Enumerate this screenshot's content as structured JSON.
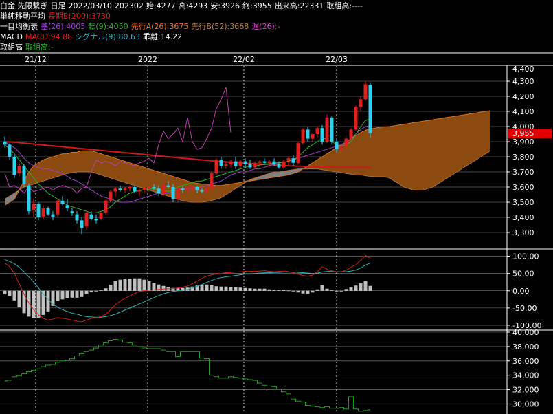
{
  "header": {
    "line1": {
      "instrument": "白金 先限繋ぎ",
      "period": "日足",
      "date": "2022/03/10",
      "contract": "202302",
      "open": "始:4277",
      "high": "高:4293",
      "low": "安:3926",
      "close": "終:3955",
      "volume": "出来高:22331",
      "oi": "取組高:----"
    },
    "line2": {
      "label": "単純移動平均",
      "ma": "長期B(200):3730"
    },
    "line3": {
      "label": "一目均衡表",
      "base": "基(26):4005",
      "conv": "転(9):4050",
      "spanA": "先行A(26):3675",
      "spanB": "先行B(52):3668",
      "lag": "遅(26):-"
    },
    "line4": {
      "label": "MACD",
      "macd": "MACD:94.88",
      "signal": "シグナル(9):80.63",
      "hist": "乖離:14.22"
    },
    "line5": {
      "label": "取組高",
      "oi": "取組高:-"
    }
  },
  "colors": {
    "up": "#e02020",
    "down": "#30d0f0",
    "ma200": "#d01818",
    "base": "#a040d0",
    "conv": "#28b828",
    "lag": "#c040b0",
    "cloud_bull": "#8a4a10",
    "cloud_bear": "#808080",
    "macd": "#d02020",
    "signal": "#30b0b8",
    "hist": "#c0c0c0",
    "oi_line": "#20a020",
    "price_badge": "#e00000"
  },
  "chart_data": [
    {
      "type": "candlestick",
      "title": "",
      "x_ticks": [
        "21/12",
        "2022",
        "22/02",
        "22/03"
      ],
      "ylim": [
        3200,
        4400
      ],
      "y_ticks": [
        3300,
        3400,
        3500,
        3600,
        3700,
        3800,
        3900,
        4000,
        4100,
        4200,
        4300
      ],
      "y_tick_labels": [
        "3,300",
        "3,400",
        "3,500",
        "3,600",
        "3,700",
        "3,800",
        "3,900",
        "4,000",
        "4,100",
        "4,200",
        "4,300",
        "4,400"
      ],
      "current_price": 3955,
      "current_price_label": "3,955",
      "ohlc": [
        [
          3900,
          3935,
          3860,
          3880
        ],
        [
          3880,
          3890,
          3780,
          3800
        ],
        [
          3800,
          3810,
          3660,
          3680
        ],
        [
          3690,
          3760,
          3670,
          3740
        ],
        [
          3740,
          3750,
          3600,
          3620
        ],
        [
          3610,
          3625,
          3420,
          3440
        ],
        [
          3450,
          3520,
          3400,
          3490
        ],
        [
          3490,
          3500,
          3380,
          3400
        ],
        [
          3405,
          3480,
          3390,
          3460
        ],
        [
          3460,
          3470,
          3410,
          3420
        ],
        [
          3420,
          3440,
          3380,
          3400
        ],
        [
          3420,
          3520,
          3400,
          3510
        ],
        [
          3510,
          3540,
          3480,
          3490
        ],
        [
          3480,
          3520,
          3440,
          3460
        ],
        [
          3440,
          3460,
          3410,
          3430
        ],
        [
          3420,
          3440,
          3360,
          3380
        ],
        [
          3380,
          3400,
          3290,
          3330
        ],
        [
          3340,
          3440,
          3320,
          3430
        ],
        [
          3420,
          3440,
          3380,
          3390
        ],
        [
          3390,
          3420,
          3360,
          3380
        ],
        [
          3390,
          3440,
          3380,
          3430
        ],
        [
          3430,
          3520,
          3420,
          3510
        ],
        [
          3510,
          3580,
          3500,
          3570
        ],
        [
          3570,
          3600,
          3540,
          3590
        ],
        [
          3590,
          3610,
          3570,
          3580
        ],
        [
          3580,
          3600,
          3560,
          3590
        ],
        [
          3590,
          3610,
          3570,
          3600
        ],
        [
          3600,
          3610,
          3560,
          3570
        ],
        [
          3570,
          3590,
          3540,
          3580
        ],
        [
          3580,
          3600,
          3560,
          3590
        ],
        [
          3590,
          3610,
          3570,
          3600
        ],
        [
          3600,
          3620,
          3580,
          3590
        ],
        [
          3590,
          3610,
          3540,
          3560
        ],
        [
          3560,
          3620,
          3540,
          3610
        ],
        [
          3610,
          3640,
          3590,
          3600
        ],
        [
          3600,
          3620,
          3500,
          3520
        ],
        [
          3520,
          3600,
          3500,
          3590
        ],
        [
          3590,
          3610,
          3560,
          3580
        ],
        [
          3580,
          3600,
          3560,
          3590
        ],
        [
          3590,
          3610,
          3570,
          3600
        ],
        [
          3600,
          3610,
          3560,
          3580
        ],
        [
          3580,
          3590,
          3560,
          3570
        ],
        [
          3570,
          3600,
          3560,
          3590
        ],
        [
          3590,
          3700,
          3580,
          3690
        ],
        [
          3690,
          3790,
          3680,
          3780
        ],
        [
          3780,
          3800,
          3720,
          3740
        ],
        [
          3740,
          3770,
          3720,
          3750
        ],
        [
          3750,
          3780,
          3730,
          3770
        ],
        [
          3770,
          3800,
          3720,
          3740
        ],
        [
          3740,
          3780,
          3720,
          3770
        ],
        [
          3770,
          3790,
          3730,
          3750
        ],
        [
          3750,
          3780,
          3720,
          3730
        ],
        [
          3730,
          3770,
          3720,
          3760
        ],
        [
          3760,
          3780,
          3740,
          3770
        ],
        [
          3770,
          3790,
          3750,
          3760
        ],
        [
          3760,
          3780,
          3740,
          3770
        ],
        [
          3770,
          3790,
          3740,
          3750
        ],
        [
          3750,
          3770,
          3720,
          3730
        ],
        [
          3730,
          3780,
          3720,
          3770
        ],
        [
          3770,
          3800,
          3740,
          3790
        ],
        [
          3790,
          3810,
          3740,
          3760
        ],
        [
          3760,
          3900,
          3750,
          3890
        ],
        [
          3890,
          3990,
          3880,
          3980
        ],
        [
          3980,
          4000,
          3900,
          3920
        ],
        [
          3920,
          3960,
          3900,
          3950
        ],
        [
          3950,
          4000,
          3930,
          3990
        ],
        [
          3990,
          4010,
          3880,
          3900
        ],
        [
          3900,
          4080,
          3890,
          4060
        ],
        [
          4060,
          4070,
          3880,
          3900
        ],
        [
          3900,
          3920,
          3830,
          3850
        ],
        [
          3850,
          3880,
          3830,
          3870
        ],
        [
          3870,
          3930,
          3860,
          3920
        ],
        [
          3920,
          3990,
          3900,
          3980
        ],
        [
          3980,
          4140,
          3970,
          4130
        ],
        [
          4130,
          4200,
          4100,
          4180
        ],
        [
          4180,
          4300,
          4170,
          4280
        ],
        [
          4277,
          4293,
          3926,
          3955
        ]
      ],
      "ma200": [
        3900,
        3898,
        3896,
        3893,
        3890,
        3887,
        3884,
        3881,
        3878,
        3875,
        3872,
        3869,
        3866,
        3863,
        3860,
        3857,
        3854,
        3851,
        3848,
        3845,
        3842,
        3839,
        3836,
        3833,
        3830,
        3827,
        3824,
        3821,
        3818,
        3815,
        3812,
        3809,
        3806,
        3803,
        3800,
        3797,
        3794,
        3791,
        3788,
        3785,
        3782,
        3779,
        3776,
        3773,
        3770,
        3768,
        3766,
        3764,
        3762,
        3760,
        3758,
        3756,
        3754,
        3752,
        3750,
        3748,
        3746,
        3744,
        3742,
        3740,
        3739,
        3738,
        3737,
        3736,
        3735,
        3734,
        3733,
        3732,
        3731,
        3730,
        3730,
        3730,
        3730,
        3730,
        3730,
        3730,
        3730
      ],
      "kijun": [
        3900,
        3880,
        3860,
        3830,
        3790,
        3760,
        3740,
        3730,
        3720,
        3720,
        3710,
        3700,
        3690,
        3670,
        3650,
        3640,
        3620,
        3600,
        3580,
        3560,
        3540,
        3530,
        3520,
        3510,
        3500,
        3500,
        3500,
        3510,
        3520,
        3530,
        3540,
        3550,
        3560,
        3560,
        3560,
        3570,
        3580,
        3590,
        3590,
        3590,
        3600,
        3600,
        3610,
        3620,
        3630,
        3640,
        3660,
        3680,
        3690,
        3700,
        3700,
        3710,
        3720,
        3720,
        3730,
        3740,
        3750,
        3760,
        3760,
        3770,
        3780,
        3790,
        3800,
        3810,
        3820,
        3830,
        3840,
        3850,
        3860,
        3870,
        3880,
        3900,
        3920,
        3950,
        3980,
        4000,
        4005
      ],
      "tenkan": [
        3880,
        3850,
        3820,
        3780,
        3740,
        3700,
        3660,
        3620,
        3590,
        3560,
        3540,
        3520,
        3500,
        3480,
        3470,
        3460,
        3450,
        3440,
        3430,
        3430,
        3440,
        3450,
        3470,
        3500,
        3520,
        3540,
        3560,
        3570,
        3580,
        3580,
        3590,
        3590,
        3580,
        3580,
        3570,
        3580,
        3600,
        3610,
        3620,
        3630,
        3640,
        3640,
        3650,
        3660,
        3670,
        3680,
        3690,
        3700,
        3710,
        3720,
        3730,
        3740,
        3740,
        3745,
        3750,
        3755,
        3760,
        3760,
        3765,
        3770,
        3780,
        3800,
        3830,
        3860,
        3880,
        3900,
        3920,
        3920,
        3900,
        3880,
        3870,
        3880,
        3900,
        3950,
        4000,
        4040,
        4050
      ],
      "chikou": [
        3690,
        3600,
        3610,
        3590,
        3560,
        3600,
        3570,
        3580,
        3590,
        3600,
        3580,
        3600,
        3610,
        3600,
        3590,
        3560,
        3590,
        3600,
        3700,
        3780,
        3760,
        3770,
        3760,
        3740,
        3770,
        3760,
        3750,
        3740,
        3760,
        3770,
        3790,
        3760,
        3880,
        3970,
        3920,
        3950,
        3990,
        3900,
        4060,
        3900,
        3850,
        3860,
        3920,
        3990,
        4120,
        4180,
        4260,
        3960
      ],
      "span_a": [
        3480,
        3500,
        3520,
        3580,
        3640,
        3700,
        3740,
        3760,
        3780,
        3790,
        3800,
        3810,
        3820,
        3820,
        3830,
        3830,
        3840,
        3840,
        3840,
        3830,
        3820,
        3810,
        3800,
        3790,
        3780,
        3770,
        3760,
        3750,
        3740,
        3730,
        3720,
        3710,
        3700,
        3690,
        3680,
        3670,
        3660,
        3650,
        3640,
        3630,
        3625,
        3620,
        3620,
        3615,
        3610,
        3610,
        3615,
        3620,
        3625,
        3630,
        3640,
        3640,
        3645,
        3650,
        3655,
        3660,
        3665,
        3670,
        3675,
        3680,
        3690,
        3700,
        3720,
        3740,
        3760,
        3780,
        3800,
        3820,
        3840,
        3860,
        3880,
        3900,
        3920,
        3940,
        3960,
        3975,
        3985,
        3990,
        3995,
        3998,
        4000,
        4005,
        4010,
        4015,
        4020,
        4025,
        4030,
        4035,
        4040,
        4045,
        4050,
        4055,
        4060,
        4065,
        4070,
        4075,
        4080,
        4085,
        4090,
        4095,
        4100,
        4105
      ],
      "span_b": [
        3520,
        3540,
        3560,
        3580,
        3600,
        3610,
        3620,
        3630,
        3640,
        3650,
        3660,
        3670,
        3680,
        3690,
        3695,
        3700,
        3700,
        3700,
        3700,
        3690,
        3680,
        3670,
        3660,
        3650,
        3640,
        3630,
        3620,
        3610,
        3600,
        3590,
        3580,
        3570,
        3560,
        3550,
        3540,
        3530,
        3520,
        3510,
        3505,
        3500,
        3500,
        3500,
        3505,
        3510,
        3520,
        3530,
        3550,
        3570,
        3590,
        3610,
        3630,
        3650,
        3660,
        3670,
        3680,
        3690,
        3700,
        3700,
        3705,
        3710,
        3715,
        3720,
        3720,
        3720,
        3720,
        3720,
        3715,
        3710,
        3705,
        3700,
        3695,
        3690,
        3685,
        3680,
        3680,
        3675,
        3670,
        3668,
        3668,
        3668,
        3660,
        3640,
        3620,
        3600,
        3590,
        3580,
        3580,
        3580,
        3590,
        3600,
        3620,
        3640,
        3660,
        3680,
        3700,
        3720,
        3740,
        3760,
        3780,
        3800,
        3820,
        3840
      ]
    },
    {
      "type": "macd",
      "ylim": [
        -110,
        115
      ],
      "y_ticks": [
        100,
        50,
        0,
        -50,
        -100
      ],
      "y_tick_labels": [
        "100.00",
        "50.00",
        "0.00",
        "-50.00",
        "-100.00"
      ],
      "macd": [
        80,
        70,
        50,
        20,
        -10,
        -35,
        -55,
        -70,
        -80,
        -85,
        -82,
        -78,
        -80,
        -82,
        -85,
        -88,
        -90,
        -85,
        -80,
        -78,
        -75,
        -68,
        -55,
        -40,
        -30,
        -22,
        -15,
        -8,
        -2,
        0,
        2,
        3,
        4,
        5,
        6,
        6,
        8,
        10,
        14,
        20,
        28,
        36,
        42,
        46,
        48,
        50,
        52,
        53,
        54,
        55,
        56,
        56,
        56,
        57,
        58,
        56,
        55,
        56,
        57,
        55,
        52,
        48,
        44,
        42,
        45,
        55,
        70,
        62,
        58,
        54,
        55,
        60,
        68,
        75,
        88,
        102,
        95
      ],
      "signal": [
        90,
        85,
        78,
        68,
        55,
        40,
        25,
        8,
        -10,
        -25,
        -38,
        -48,
        -55,
        -60,
        -65,
        -68,
        -72,
        -75,
        -76,
        -77,
        -77,
        -75,
        -72,
        -68,
        -62,
        -56,
        -50,
        -44,
        -38,
        -32,
        -26,
        -20,
        -14,
        -9,
        -5,
        -2,
        0,
        2,
        5,
        8,
        13,
        18,
        24,
        30,
        35,
        38,
        40,
        42,
        44,
        46,
        48,
        49,
        50,
        51,
        52,
        52,
        53,
        53,
        54,
        54,
        54,
        53,
        52,
        51,
        50,
        51,
        54,
        56,
        56,
        55,
        55,
        55,
        57,
        60,
        66,
        74,
        80
      ],
      "histogram": [
        -10,
        -15,
        -28,
        -48,
        -65,
        -75,
        -80,
        -78,
        -70,
        -60,
        -44,
        -30,
        -25,
        -22,
        -20,
        -20,
        -18,
        -10,
        -4,
        -1,
        2,
        7,
        17,
        28,
        32,
        34,
        35,
        36,
        36,
        32,
        28,
        23,
        18,
        14,
        11,
        8,
        8,
        8,
        9,
        12,
        15,
        18,
        18,
        16,
        13,
        12,
        12,
        11,
        10,
        9,
        8,
        7,
        6,
        6,
        6,
        4,
        2,
        3,
        3,
        1,
        -2,
        -5,
        -8,
        -9,
        -5,
        4,
        16,
        6,
        2,
        -1,
        0,
        5,
        11,
        15,
        22,
        28,
        14
      ]
    },
    {
      "type": "line",
      "ylim": [
        28800,
        40000
      ],
      "y_ticks": [
        30000,
        32000,
        34000,
        36000,
        38000,
        40000
      ],
      "y_tick_labels": [
        "30,000",
        "32,000",
        "34,000",
        "36,000",
        "38,000",
        "40,000"
      ],
      "open_interest": [
        33200,
        33300,
        33800,
        33900,
        34200,
        34500,
        34700,
        34900,
        35200,
        35400,
        35500,
        35800,
        36000,
        36100,
        36300,
        36700,
        37000,
        37300,
        37500,
        37800,
        38200,
        38500,
        38800,
        39000,
        38900,
        38600,
        38500,
        38200,
        38000,
        37800,
        37700,
        37700,
        37700,
        37500,
        37300,
        37300,
        36600,
        37300,
        37300,
        37300,
        37300,
        36400,
        36300,
        34000,
        33800,
        33600,
        33600,
        33800,
        33700,
        33600,
        33500,
        33400,
        33300,
        32900,
        32600,
        32500,
        32400,
        32100,
        31700,
        31400,
        30700,
        30400,
        30300,
        29800,
        29700,
        29600,
        29500,
        29600,
        29400,
        29400,
        29500,
        29300,
        31000,
        29300,
        29000,
        29100,
        29200
      ]
    }
  ]
}
